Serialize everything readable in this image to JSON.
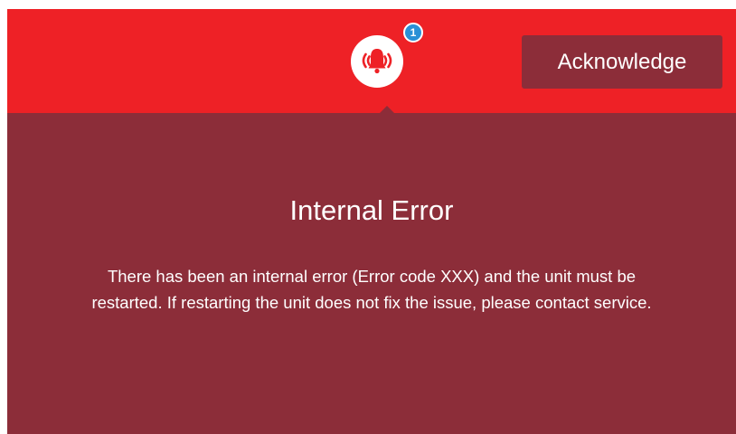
{
  "header": {
    "background_color": "#ee2126",
    "alarm": {
      "icon": "bell-alarm-icon",
      "badge_count": "1",
      "badge_color": "#2a90d6"
    },
    "acknowledge_label": "Acknowledge"
  },
  "alert": {
    "background_color": "#8c2d39",
    "title": "Internal Error",
    "message": "There has been an internal error (Error code XXX) and the unit must be restarted. If restarting the unit does not fix the issue, please contact service."
  }
}
